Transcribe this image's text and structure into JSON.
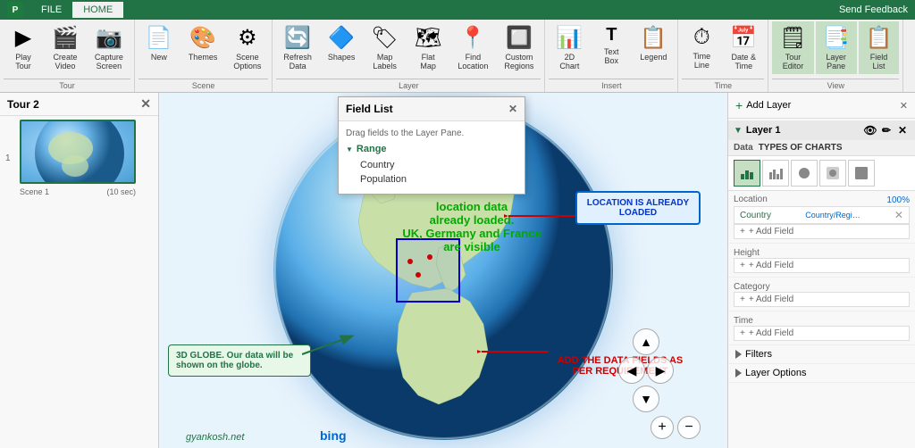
{
  "titlebar": {
    "app_label": "Send Feedback",
    "file_tab": "FILE",
    "home_tab": "HOME"
  },
  "ribbon": {
    "groups": [
      {
        "name": "Tour",
        "buttons": [
          {
            "id": "play-tour",
            "icon": "▶",
            "label": "Play\nTour"
          },
          {
            "id": "create-video",
            "icon": "🎬",
            "label": "Create\nVideo"
          },
          {
            "id": "capture-screen",
            "icon": "📷",
            "label": "Capture\nScreen"
          }
        ]
      },
      {
        "name": "Scene",
        "buttons": [
          {
            "id": "new",
            "icon": "📄",
            "label": "New"
          },
          {
            "id": "themes",
            "icon": "🎨",
            "label": "Themes"
          },
          {
            "id": "scene-options",
            "icon": "⚙",
            "label": "Scene\nOptions"
          }
        ]
      },
      {
        "name": "Layer",
        "buttons": [
          {
            "id": "refresh-data",
            "icon": "🔄",
            "label": "Refresh\nData"
          },
          {
            "id": "shapes",
            "icon": "🔷",
            "label": "Shapes"
          },
          {
            "id": "map-labels",
            "icon": "🏷",
            "label": "Map\nLabels"
          },
          {
            "id": "flat-map",
            "icon": "🗺",
            "label": "Flat\nMap"
          },
          {
            "id": "find-location",
            "icon": "📍",
            "label": "Find\nLocation"
          },
          {
            "id": "custom-regions",
            "icon": "🔲",
            "label": "Custom\nRegions"
          }
        ]
      },
      {
        "name": "Insert",
        "buttons": [
          {
            "id": "2d-chart",
            "icon": "📊",
            "label": "2D\nChart"
          },
          {
            "id": "text-box",
            "icon": "T",
            "label": "Text\nBox"
          },
          {
            "id": "legend",
            "icon": "📋",
            "label": "Legend"
          }
        ]
      },
      {
        "name": "Time",
        "buttons": [
          {
            "id": "time-line",
            "icon": "⏱",
            "label": "Time\nLine"
          },
          {
            "id": "date-time",
            "icon": "📅",
            "label": "Date &\nTime"
          }
        ]
      },
      {
        "name": "View",
        "buttons": [
          {
            "id": "tour-editor",
            "icon": "🗒",
            "label": "Tour\nEditor",
            "active": true
          },
          {
            "id": "layer-pane",
            "icon": "📑",
            "label": "Layer\nPane",
            "active": true
          },
          {
            "id": "field-list",
            "icon": "📋",
            "label": "Field\nList",
            "active": true
          }
        ]
      }
    ]
  },
  "tour_panel": {
    "title": "Tour 2",
    "close_label": "✕",
    "scene": {
      "num": "1",
      "label": "Scene 1",
      "duration": "(10 sec)"
    }
  },
  "globe_annotations": {
    "green_text": {
      "line1": "location data",
      "line2": "already loaded.",
      "line3": "UK, Germany and France",
      "line4": "are visible"
    },
    "callout_3d": {
      "text": "3D GLOBE. Our data will be shown on the globe."
    },
    "callout_location": {
      "text": "LOCATION IS ALREADY LOADED"
    },
    "callout_data": {
      "text": "ADD THE DATA FIELDS AS PER REQUIREMENT"
    }
  },
  "field_list_popup": {
    "title": "Field List",
    "hint": "Drag fields to the Layer Pane.",
    "close_label": "✕",
    "sections": [
      {
        "name": "Range",
        "fields": [
          "Country",
          "Population"
        ]
      }
    ]
  },
  "right_panel": {
    "add_layer_label": "Add Layer",
    "close_label": "✕",
    "layer": {
      "name": "Layer 1",
      "data_label": "Data",
      "types_label": "TYPES OF CHARTS",
      "chart_types": [
        {
          "id": "stacked",
          "icon": "▦",
          "active": true
        },
        {
          "id": "bar",
          "icon": "📊",
          "active": false
        },
        {
          "id": "bubble",
          "icon": "⬤",
          "active": false
        },
        {
          "id": "heat",
          "icon": "◈",
          "active": false
        },
        {
          "id": "region",
          "icon": "⬛",
          "active": false
        }
      ],
      "location": {
        "label": "Location",
        "pct": "100%",
        "field": "Country",
        "field_type": "Country/Regi…",
        "add_label": "+ Add Field"
      },
      "height": {
        "label": "Height",
        "add_label": "+ Add Field"
      },
      "category": {
        "label": "Category",
        "add_label": "+ Add Field"
      },
      "time": {
        "label": "Time",
        "add_label": "+ Add Field"
      },
      "filters_label": "Filters",
      "layer_options_label": "Layer Options"
    }
  },
  "watermark": "gyankosh.net",
  "bing_label": "bing"
}
